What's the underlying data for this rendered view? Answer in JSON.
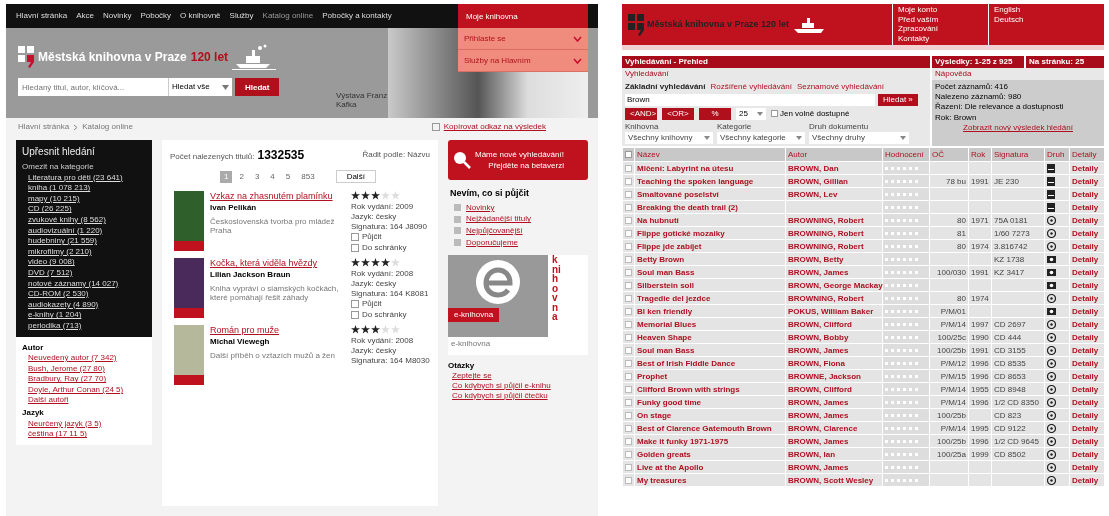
{
  "left_page": {
    "nav": [
      {
        "label": "Hlavní stránka",
        "selected": false
      },
      {
        "label": "Akce",
        "selected": false
      },
      {
        "label": "Novinky",
        "selected": false
      },
      {
        "label": "Pobočky",
        "selected": false
      },
      {
        "label": "O knihovně",
        "selected": false
      },
      {
        "label": "Služby",
        "selected": false
      },
      {
        "label": "Katalog online",
        "selected": true
      },
      {
        "label": "Pobočky a kontakty",
        "selected": false
      }
    ],
    "account": {
      "title": "Moje knihovna",
      "dropdowns": [
        "Přihlaste se",
        "Služby na Hlavním"
      ]
    },
    "logo": {
      "name": "Městská knihovna v Praze",
      "anniversary": "120 let"
    },
    "search": {
      "placeholder": "Hledaný titul, autor, klíčová...",
      "scope": "Hledat vše",
      "button": "Hledat"
    },
    "header_caption": "Výstava Franz Kafka",
    "breadcrumb": [
      "Hlavní stránka",
      "Katalog online"
    ],
    "permalink": "Kopírovat odkaz na výsledek",
    "refine": {
      "title": "Upřesnit hledání",
      "subtitle": "Omezit na kategorie",
      "items": [
        "Literatura pro děti (23 641)",
        "kniha (1 078 213)",
        "mapy (10 215)",
        "CD (26 225)",
        "zvukové knihy (8 562)",
        "audiovizuální (1 220)",
        "hudebniny (21 559)",
        "mikrofilmy (2 210)",
        "video (9 008)",
        "DVD (7 512)",
        "notové záznamy (14 027)",
        "CD-ROM (2 530)",
        "audiokazety (4 890)",
        "e-knihy (1 204)",
        "periodika (713)"
      ]
    },
    "facets": [
      {
        "title": "Autor",
        "items": [
          "Neuvedený autor (7 342)",
          "Bush, Jerome (27 80)",
          "Bradbury, Ray (27 70)",
          "Doyle, Arthur Conan (24 5)",
          "Další autoři"
        ]
      },
      {
        "title": "Jazyk",
        "items": [
          "Neurčený jazyk (3 5)",
          "čeština (17 11 5)"
        ]
      }
    ],
    "results": {
      "count_label": "Počet nalezených titulů:",
      "count": "1332535",
      "sort_label": "Řadit podle: Názvu",
      "pages": [
        {
          "label": "1",
          "selected": true
        },
        {
          "label": "2",
          "selected": false
        },
        {
          "label": "3",
          "selected": false
        },
        {
          "label": "4",
          "selected": false
        },
        {
          "label": "5",
          "selected": false
        },
        {
          "label": "853",
          "selected": false
        }
      ],
      "next": "Další"
    },
    "books": [
      {
        "title": "Vzkaz na zhasnutém plamínku",
        "author": "Ivan Pelikán",
        "description": "Československá tvorba pro mládež Praha",
        "stars": 3,
        "meta": [
          "Rok vydání: 2009",
          "Jazyk: česky",
          "Signatura: 164 J8090"
        ],
        "actions": [
          "Půjčit",
          "Do schránky"
        ]
      },
      {
        "title": "Kočka, která viděla hvězdy",
        "author": "Lilian Jackson Braun",
        "description": "Kniha vypráví o siamských kočkách, které pomáhají řešit záhady",
        "stars": 4,
        "meta": [
          "Rok vydání: 2008",
          "Jazyk: česky",
          "Signatura: 164 K8081"
        ],
        "actions": [
          "Půjčit",
          "Do schránky"
        ]
      },
      {
        "title": "Román pro muže",
        "author": "Michal Viewegh",
        "description": "Další příběh o vztazích mužů a žen",
        "stars": 3,
        "meta": [
          "Rok vydání: 2008",
          "Jazyk: česky",
          "Signatura: 164 M8030"
        ]
      }
    ],
    "promo": {
      "line1": "Máme nové vyhledávání!",
      "line2": "Přejděte na betaverzi"
    },
    "suggest": {
      "title": "Nevím, co si půjčit",
      "links": [
        "Novinky",
        "Nejžádanější tituly",
        "Nejpůjčovanější",
        "Doporučujeme"
      ]
    },
    "ebook": {
      "tag": "e-knihovna",
      "side": "knihovna",
      "caption": "e-knihovna"
    },
    "questions": {
      "title": "Otázky",
      "items": [
        "Zeptejte se",
        "Co kdybych si půjčil e-knihu",
        "Co kdybych si půjčil čtečku"
      ]
    }
  },
  "right_page": {
    "logo": {
      "name": "Městská knihovna v Praze 120 let"
    },
    "links": [
      "Moje konto",
      "Před vaším",
      "Zpracování",
      "Kontakty"
    ],
    "languages": [
      "English",
      "Deutsch"
    ],
    "bar": {
      "title": "Vyhledávání - Přehled",
      "records": "Výsledky: 1-25 z 925",
      "per_page": "Na stránku: 25"
    },
    "labels": {
      "search": "Vyhledávání",
      "help": "Nápověda"
    },
    "tabs": [
      {
        "label": "Základní vyhledávání",
        "selected": true
      },
      {
        "label": "Rozšířené vyhledávání",
        "selected": false
      },
      {
        "label": "Seznamové vyhledávání",
        "selected": false
      }
    ],
    "query": {
      "value": "Brown",
      "button": "Hledat »"
    },
    "operators": [
      "<AND>",
      "<OR>",
      "%"
    ],
    "limit": {
      "value": "25",
      "label": "Jen volně dostupné"
    },
    "filters": [
      {
        "label": "Knihovna",
        "value": "Všechny knihovny"
      },
      {
        "label": "Kategorie",
        "value": "Všechny kategorie"
      },
      {
        "label": "Druh dokumentu",
        "value": "Všechny druhy"
      }
    ],
    "info": {
      "count": "Počet záznamů: 416",
      "found": "Nalezeno záznamů: 980",
      "sort": "Řazení: Dle relevance a dostupnosti",
      "year": "Rok: Brown",
      "link": "Zobrazit nový výsledek hledání"
    },
    "table": {
      "columns": [
        "Název",
        "Autor",
        "Hodnocení",
        "OČ",
        "Rok",
        "Signatura",
        "Druh",
        "Detaily"
      ],
      "rows": [
        {
          "title": "Mlčení: Labyrint na útesu",
          "author": "BROWN, Dan",
          "shelf": "",
          "year": "",
          "signature": "",
          "kind": "book",
          "detail": "Detaily"
        },
        {
          "title": "Teaching the spoken language",
          "author": "BROWN, Gillian",
          "shelf": "78 bu",
          "year": "1991",
          "signature": "JE 230",
          "kind": "book",
          "detail": "Detaily"
        },
        {
          "title": "Smaltované poselství",
          "author": "BROWN, Lev",
          "shelf": "",
          "year": "",
          "signature": "",
          "kind": "book",
          "detail": "Detaily"
        },
        {
          "title": "Breaking the death trail (2)",
          "author": "",
          "shelf": "",
          "year": "",
          "signature": "",
          "kind": "book",
          "detail": "Detaily"
        },
        {
          "title": "Na hubnutí",
          "author": "BROWNING, Robert",
          "shelf": "80",
          "year": "1971",
          "signature": "75A 0181",
          "kind": "cd",
          "detail": "Detaily"
        },
        {
          "title": "Flippe gotické mozaiky",
          "author": "BROWNING, Robert",
          "shelf": "81",
          "year": "",
          "signature": "1/60 7273",
          "kind": "cd",
          "detail": "Detaily"
        },
        {
          "title": "Flippe jde zabíjet",
          "author": "BROWNING, Robert",
          "shelf": "80",
          "year": "1974",
          "signature": "3.816742",
          "kind": "cd",
          "detail": "Detaily"
        },
        {
          "title": "Betty Brown",
          "author": "BROWN, Betty",
          "shelf": "",
          "year": "",
          "signature": "KZ 1738",
          "kind": "video",
          "detail": "Detaily"
        },
        {
          "title": "Soul man Bass",
          "author": "BROWN, James",
          "shelf": "100/030",
          "year": "1991",
          "signature": "KZ 3417",
          "kind": "video",
          "detail": "Detaily"
        },
        {
          "title": "Silberstein soll",
          "author": "BROWN, George Mackay",
          "shelf": "",
          "year": "",
          "signature": "",
          "kind": "video",
          "detail": "Detaily"
        },
        {
          "title": "Tragedie del jezdce",
          "author": "BROWNING, Robert",
          "shelf": "80",
          "year": "1974",
          "signature": "",
          "kind": "cd",
          "detail": "Detaily"
        },
        {
          "title": "Bl ken friendly",
          "author": "POKUS, William Baker",
          "shelf": "P/M/01",
          "year": "",
          "signature": "",
          "kind": "video",
          "detail": "Detaily"
        },
        {
          "title": "Memorial Blues",
          "author": "BROWN, Clifford",
          "shelf": "P/M/14",
          "year": "1997",
          "signature": "CD 2697",
          "kind": "cd",
          "detail": "Detaily"
        },
        {
          "title": "Heaven Shape",
          "author": "BROWN, Bobby",
          "shelf": "100/25c",
          "year": "1990",
          "signature": "CD 444",
          "kind": "cd",
          "detail": "Detaily"
        },
        {
          "title": "Soul man Bass",
          "author": "BROWN, James",
          "shelf": "100/25b",
          "year": "1991",
          "signature": "CD 3155",
          "kind": "cd",
          "detail": "Detaily"
        },
        {
          "title": "Best of Irish Fiddle Dance",
          "author": "BROWN, Fiona",
          "shelf": "P/M/12",
          "year": "1996",
          "signature": "CD 8535",
          "kind": "cd",
          "detail": "Detaily"
        },
        {
          "title": "Prophet",
          "author": "BROWNE, Jackson",
          "shelf": "P/M/15",
          "year": "1996",
          "signature": "CD 8653",
          "kind": "cd",
          "detail": "Detaily"
        },
        {
          "title": "Clifford Brown with strings",
          "author": "BROWN, Clifford",
          "shelf": "P/M/14",
          "year": "1955",
          "signature": "CD 8948",
          "kind": "cd",
          "detail": "Detaily"
        },
        {
          "title": "Funky good time",
          "author": "BROWN, James",
          "shelf": "P/M/14",
          "year": "1996",
          "signature": "1/2 CD 8350",
          "kind": "cd",
          "detail": "Detaily"
        },
        {
          "title": "On stage",
          "author": "BROWN, James",
          "shelf": "100/25b",
          "year": "",
          "signature": "CD 823",
          "kind": "cd",
          "detail": "Detaily"
        },
        {
          "title": "Best of Clarence Gatemouth Brown",
          "author": "BROWN, Clarence",
          "shelf": "P/M/14",
          "year": "1995",
          "signature": "CD 9122",
          "kind": "cd",
          "detail": "Detaily"
        },
        {
          "title": "Make it funky 1971-1975",
          "author": "BROWN, James",
          "shelf": "100/25b",
          "year": "1996",
          "signature": "1/2 CD 9645",
          "kind": "cd",
          "detail": "Detaily"
        },
        {
          "title": "Golden greats",
          "author": "BROWN, Ian",
          "shelf": "100/25a",
          "year": "1999",
          "signature": "CD 8502",
          "kind": "cd",
          "detail": "Detaily"
        },
        {
          "title": "Live at the Apollo",
          "author": "BROWN, James",
          "shelf": "",
          "year": "",
          "signature": "",
          "kind": "cd",
          "detail": "Detaily"
        },
        {
          "title": "My treasures",
          "author": "BROWN, Scott Wesley",
          "shelf": "",
          "year": "",
          "signature": "",
          "kind": "cd",
          "detail": "Detaily"
        }
      ]
    }
  }
}
